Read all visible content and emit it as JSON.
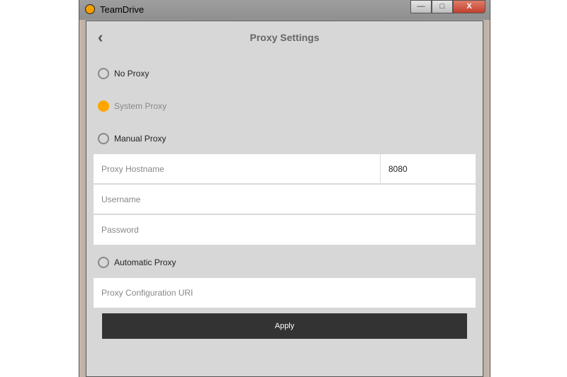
{
  "window": {
    "title": "TeamDrive",
    "minimize": "—",
    "maximize": "□",
    "close": "X"
  },
  "header": {
    "back": "‹",
    "title": "Proxy Settings"
  },
  "options": [
    {
      "label": "No Proxy",
      "selected": false
    },
    {
      "label": "System Proxy",
      "selected": true
    },
    {
      "label": "Manual Proxy",
      "selected": false
    },
    {
      "label": "Automatic Proxy",
      "selected": false
    }
  ],
  "fields": {
    "hostname_placeholder": "Proxy Hostname",
    "port": "8080",
    "username_placeholder": "Username",
    "password_placeholder": "Password",
    "uri_placeholder": "Proxy Configuration URI"
  },
  "apply": "Apply",
  "colors": {
    "accent": "#ffa500",
    "button": "#333333"
  }
}
